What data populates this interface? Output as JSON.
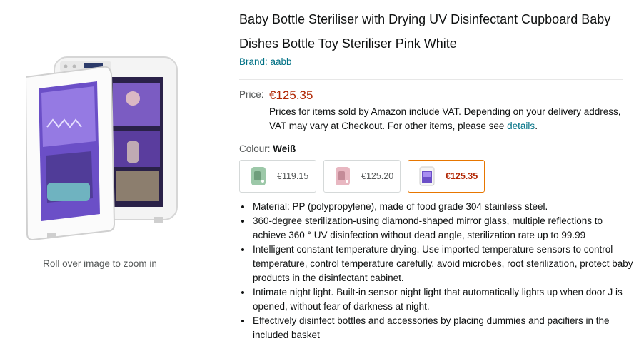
{
  "image": {
    "zoom_hint": "Roll over image to zoom in"
  },
  "product": {
    "title": "Baby Bottle Steriliser with Drying UV Disinfectant Cupboard Baby Dishes Bottle Toy Steriliser Pink White",
    "brand": "Brand: aabb"
  },
  "price": {
    "label": "Price:",
    "value": "€125.35",
    "vat_note": "Prices for items sold by Amazon include VAT. Depending on your delivery address, VAT may vary at Checkout. For other items, please see",
    "details_link": "details",
    "vat_note_end": "."
  },
  "colour": {
    "label": "Colour:",
    "selected": "Weiß",
    "options": [
      {
        "price": "€119.15",
        "color": "#9cc8a8"
      },
      {
        "price": "€125.20",
        "color": "#e8b7c1"
      },
      {
        "price": "€125.35",
        "color": "#ffffff"
      }
    ],
    "active_index": 2
  },
  "features": [
    "Material: PP (polypropylene), made of food grade 304 stainless steel.",
    "360-degree sterilization-using diamond-shaped mirror glass, multiple reflections to achieve 360 ° UV disinfection without dead angle, sterilization rate up to 99.99",
    "Intelligent constant temperature drying. Use imported temperature sensors to control temperature, control temperature carefully, avoid microbes, root sterilization, protect baby products in the disinfectant cabinet.",
    "Intimate night light. Built-in sensor night light that automatically lights up when door J is opened, without fear of darkness at night.",
    "Effectively disinfect bottles and accessories by placing dummies and pacifiers in the included basket"
  ]
}
